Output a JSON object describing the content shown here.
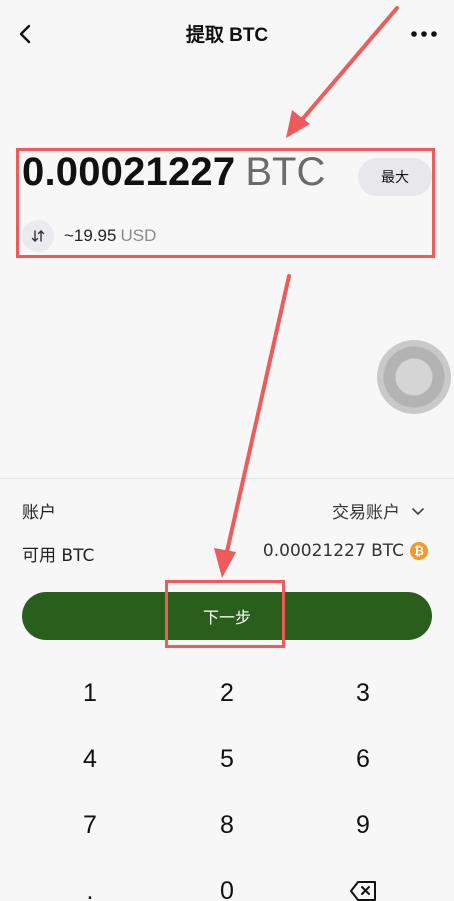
{
  "header": {
    "title": "提取 BTC"
  },
  "amount": {
    "value": "0.00021227",
    "unit": "BTC",
    "max_label": "最大"
  },
  "conversion": {
    "value": "~19.95",
    "unit": "USD"
  },
  "account": {
    "label": "账户",
    "value": "交易账户"
  },
  "available": {
    "label": "可用 BTC",
    "value": "0.00021227 BTC",
    "coin_symbol": "₿"
  },
  "next_button": {
    "label": "下一步"
  },
  "keypad": {
    "keys": [
      "1",
      "2",
      "3",
      "4",
      "5",
      "6",
      "7",
      "8",
      "9",
      ".",
      "0"
    ]
  },
  "colors": {
    "primary_button": "#2a5e1d",
    "annotation": "#ef5b5b",
    "btc_orange": "#f29a2e"
  }
}
